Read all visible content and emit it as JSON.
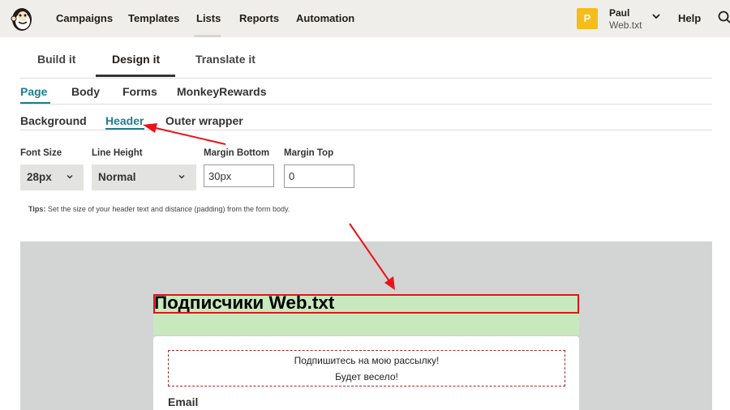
{
  "nav": {
    "items": [
      "Campaigns",
      "Templates",
      "Lists",
      "Reports",
      "Automation"
    ],
    "active": "Lists",
    "user": {
      "initial": "P",
      "name": "Paul",
      "account": "Web.txt"
    },
    "help": "Help"
  },
  "tabs_primary": [
    "Build it",
    "Design it",
    "Translate it"
  ],
  "tabs_secondary": [
    "Page",
    "Body",
    "Forms",
    "MonkeyRewards"
  ],
  "tabs_tertiary": [
    "Background",
    "Header",
    "Outer wrapper"
  ],
  "controls": {
    "font_size": {
      "label": "Font Size",
      "value": "28px"
    },
    "line_height": {
      "label": "Line Height",
      "value": "Normal"
    },
    "margin_bottom": {
      "label": "Margin Bottom",
      "value": "30px"
    },
    "margin_top": {
      "label": "Margin Top",
      "value": "0"
    }
  },
  "tips": {
    "label": "Tips:",
    "text": "Set the size of your header text and distance (padding) from the form body."
  },
  "preview": {
    "header": "Подписчики Web.txt",
    "intro_line1": "Подпишитесь на мою рассылку!",
    "intro_line2": "Будет весело!",
    "email_label": "Email"
  },
  "colors": {
    "accent": "#1d7d91",
    "nav_bg": "#efeeea",
    "avatar": "#f5bd1a",
    "header_bg": "#c8e9bd",
    "preview_bg": "#d3d4d4",
    "annotation": "#e8141b"
  },
  "icons": [
    "mailchimp-logo-icon",
    "chevron-down-icon",
    "search-icon"
  ]
}
